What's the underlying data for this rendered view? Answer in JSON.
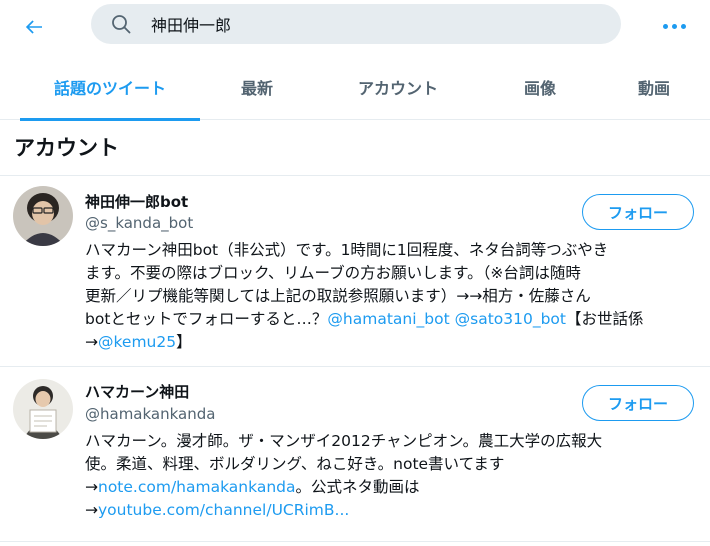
{
  "search": {
    "query": "神田伸一郎"
  },
  "tabs": [
    {
      "label": "話題のツイート"
    },
    {
      "label": "最新"
    },
    {
      "label": "アカウント"
    },
    {
      "label": "画像"
    },
    {
      "label": "動画"
    }
  ],
  "section": {
    "title": "アカウント"
  },
  "accounts": [
    {
      "name": "神田伸一郎bot",
      "handle": "@s_kanda_bot",
      "follow_label": "フォロー",
      "bio": {
        "line1": "ハマカーン神田bot（非公式）です。1時間に1回程度、ネタ台詞等つぶやき",
        "line2": "ます。不要の際はブロック、リムーブの方お願いします。（※台詞は随時",
        "line3": "更新／リプ機能等関しては上記の取説参照願います）→→相方・佐藤さん",
        "line4_pre": "botとセットでフォローすると…？",
        "mention1": "@hamatani_bot",
        "mention2": "@sato310_bot",
        "line4_post": "【お世話係",
        "line5_pre": "→",
        "mention3": "@kemu25",
        "line5_post": "】"
      }
    },
    {
      "name": "ハマカーン神田",
      "handle": "@hamakankanda",
      "follow_label": "フォロー",
      "bio": {
        "line1": "ハマカーン。漫才師。ザ・マンザイ2012チャンピオン。農工大学の広報大",
        "line2": "使。柔道、料理、ボルダリング、ねこ好き。note書いてます",
        "line3_pre": "→",
        "link1": "note.com/hamakankanda",
        "line3_post": "。公式ネタ動画は",
        "line4_pre": "→",
        "link2": "youtube.com/channel/UCRimB..."
      }
    }
  ],
  "colors": {
    "accent": "#1d9bf0",
    "text": "#0f1419",
    "muted": "#536471",
    "search_bg": "#e6ecf0"
  }
}
